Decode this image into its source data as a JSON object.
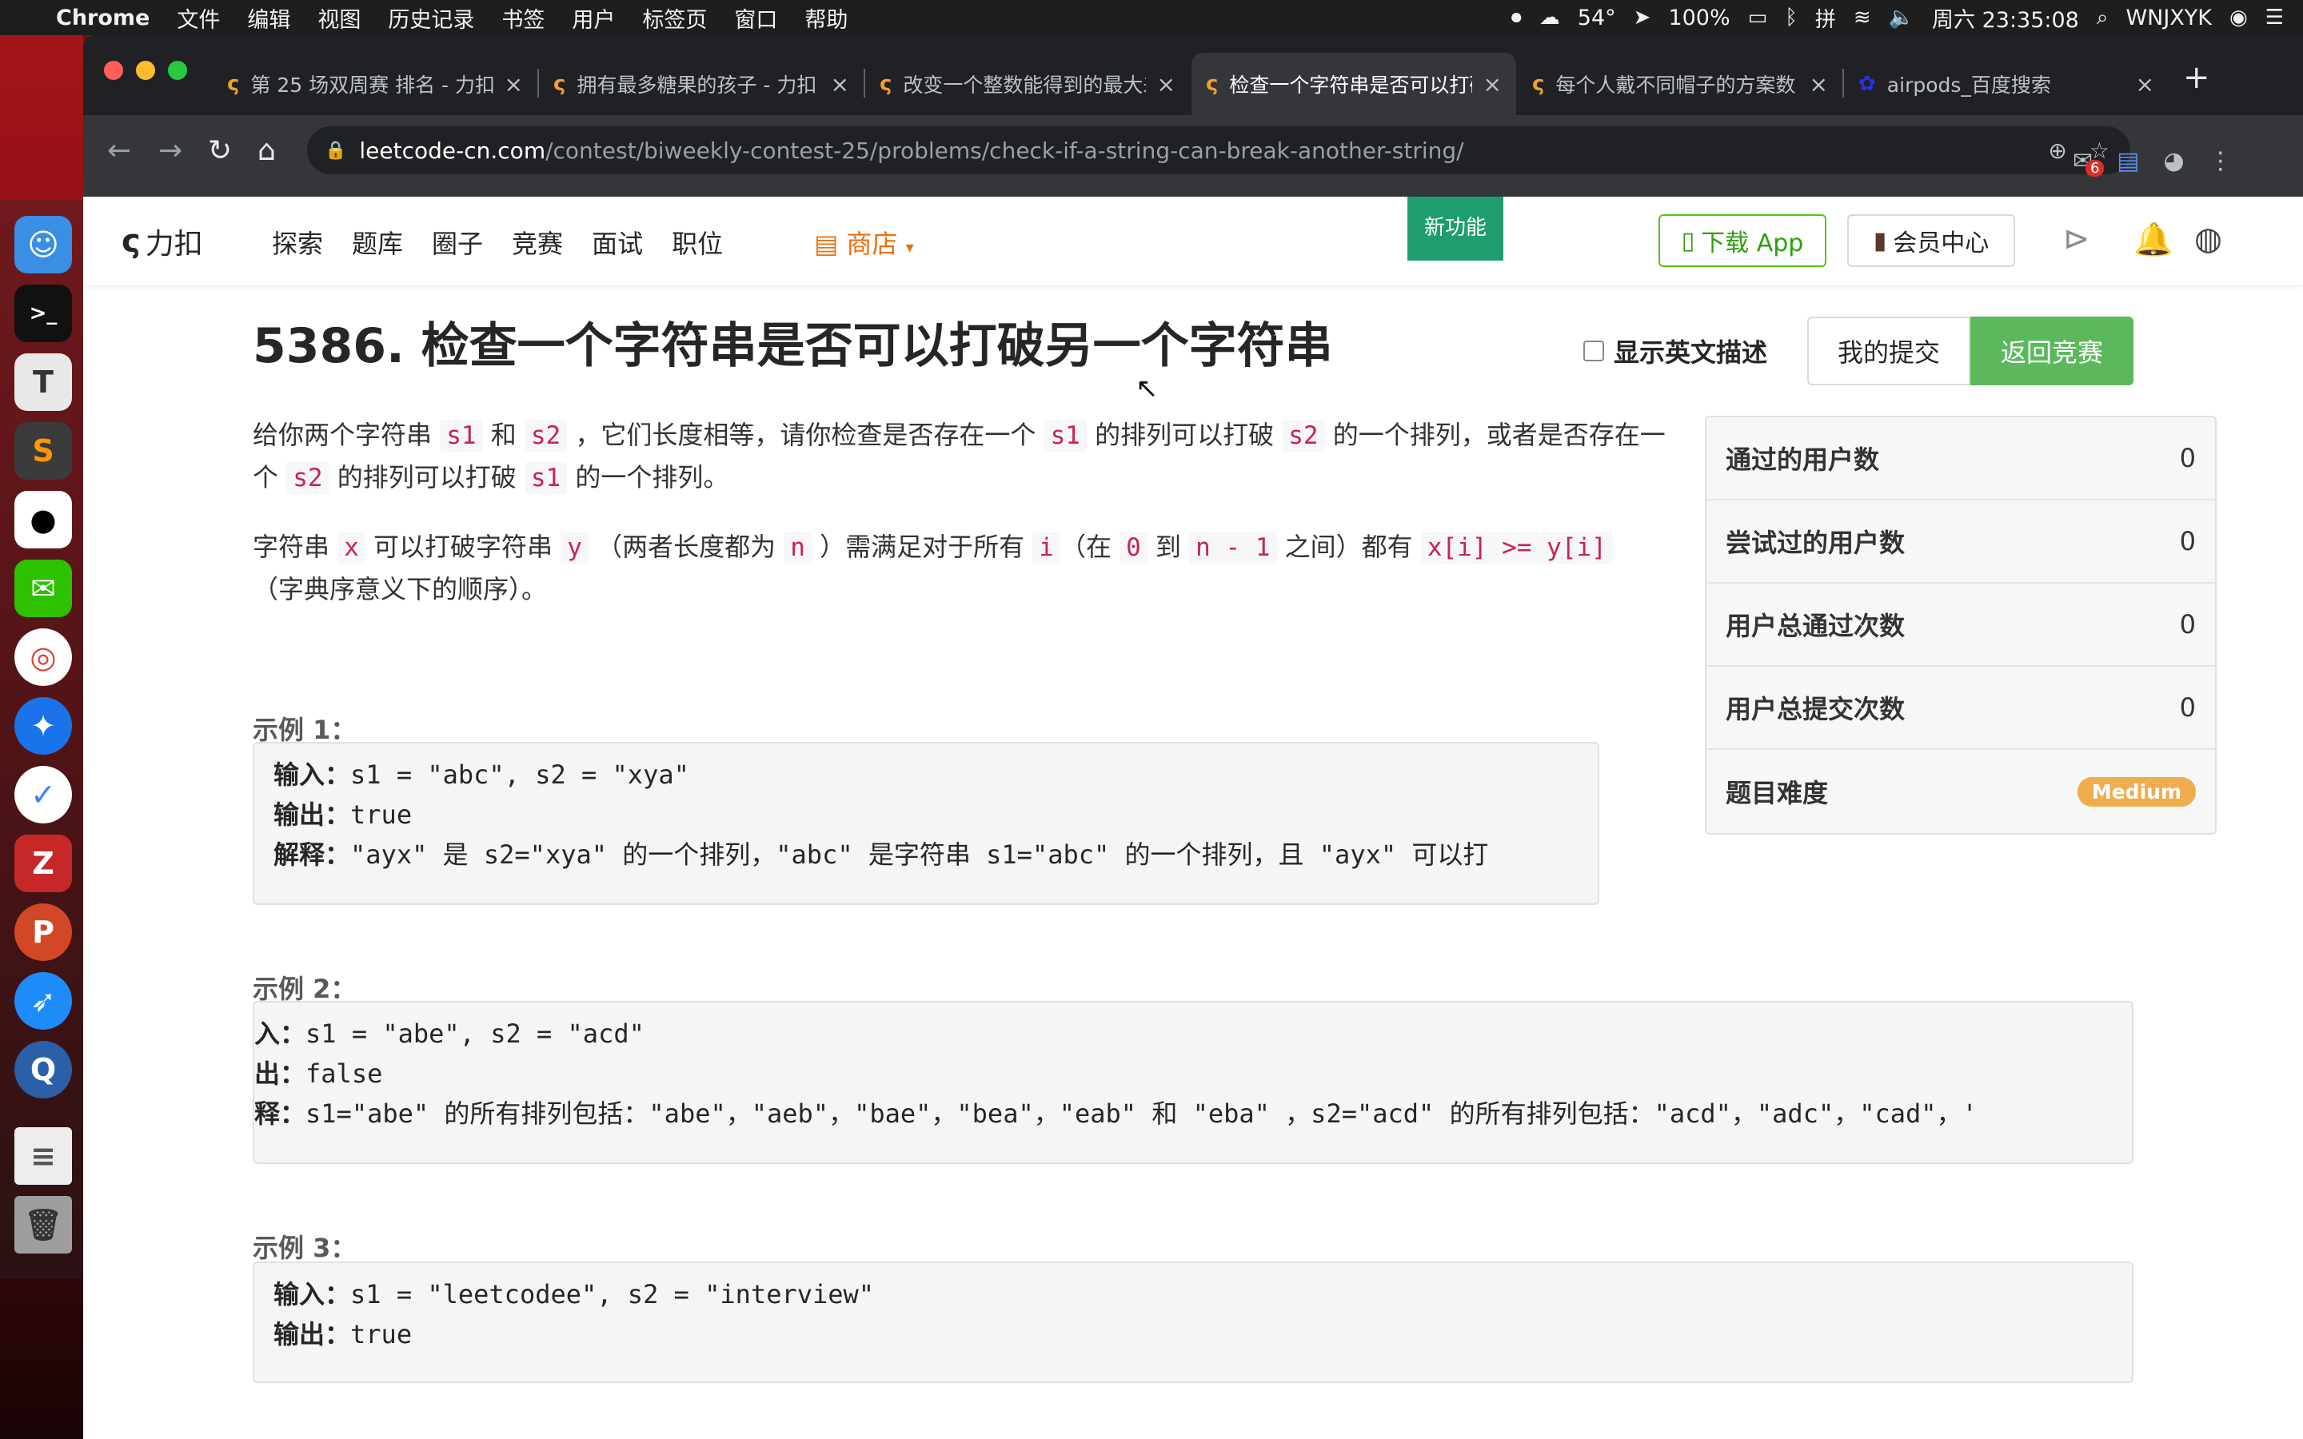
{
  "menubar": {
    "app_name": "Chrome",
    "menus": [
      "文件",
      "编辑",
      "视图",
      "历史记录",
      "书签",
      "用户",
      "标签页",
      "窗口",
      "帮助"
    ],
    "temperature": "54°",
    "battery": "100%",
    "clock": "周六 23:35:08",
    "user": "WNJXYK"
  },
  "browser": {
    "tabs": [
      {
        "title": "第 25 场双周赛 排名 - 力扣"
      },
      {
        "title": "拥有最多糖果的孩子 - 力扣"
      },
      {
        "title": "改变一个整数能得到的最大差值"
      },
      {
        "title": "检查一个字符串是否可以打破另一个字符串",
        "active": true
      },
      {
        "title": "每个人戴不同帽子的方案数"
      },
      {
        "title": "airpods_百度搜索"
      }
    ],
    "url_host": "leetcode-cn.com",
    "url_path": "/contest/biweekly-contest-25/problems/check-if-a-string-can-break-another-string/",
    "mail_badge": "6"
  },
  "lc_header": {
    "logo_text": "力扣",
    "nav": [
      "探索",
      "题库",
      "圈子",
      "竞赛",
      "面试",
      "职位"
    ],
    "shop": "商店",
    "new_feature": "新功能",
    "download_app": "下载 App",
    "vip_center": "会员中心"
  },
  "problem": {
    "title": "5386. 检查一个字符串是否可以打破另一个字符串",
    "show_english": "显示英文描述",
    "my_submissions": "我的提交",
    "back_to_contest": "返回竞赛",
    "para1": {
      "t1": "给你两个字符串 ",
      "c1": "s1",
      "t2": " 和 ",
      "c2": "s2",
      "t3": " ，它们长度相等，请你检查是否存在一个 ",
      "c3": "s1",
      "t4": " 的排列可以打破 ",
      "c4": "s2",
      "t5": " 的一个排列，或者是否存在一个 ",
      "c5": "s2",
      "t6": " 的排列可以打破 ",
      "c6": "s1",
      "t7": " 的一个排列。"
    },
    "para2": {
      "t1": "字符串 ",
      "c1": "x",
      "t2": " 可以打破字符串 ",
      "c2": "y",
      "t3": " （两者长度都为 ",
      "c3": "n",
      "t4": " ）需满足对于所有 ",
      "c4": "i",
      "t5": "（在 ",
      "c5": "0",
      "t6": " 到 ",
      "c6": "n - 1",
      "t7": " 之间）都有 ",
      "c7": "x[i] >= y[i]",
      "t8": "（字典序意义下的顺序）。"
    },
    "examples": [
      {
        "label": "示例 1：",
        "lines": [
          {
            "k": "输入：",
            "v": "s1 = \"abc\", s2 = \"xya\""
          },
          {
            "k": "输出：",
            "v": "true"
          },
          {
            "k": "解释：",
            "v": "\"ayx\" 是 s2=\"xya\" 的一个排列，\"abc\" 是字符串 s1=\"abc\" 的一个排列，且 \"ayx\" 可以打"
          }
        ]
      },
      {
        "label": "示例 2：",
        "lines": [
          {
            "k": "入：",
            "v": "s1 = \"abe\", s2 = \"acd\""
          },
          {
            "k": "出：",
            "v": "false"
          },
          {
            "k": "释：",
            "v": "s1=\"abe\" 的所有排列包括：\"abe\"，\"aeb\"，\"bae\"，\"bea\"，\"eab\" 和 \"eba\" ，s2=\"acd\" 的所有排列包括：\"acd\"，\"adc\"，\"cad\"，'"
          }
        ]
      },
      {
        "label": "示例 3：",
        "lines": [
          {
            "k": "输入：",
            "v": "s1 = \"leetcodee\", s2 = \"interview\""
          },
          {
            "k": "输出：",
            "v": "true"
          }
        ]
      }
    ]
  },
  "stats": [
    {
      "label": "通过的用户数",
      "value": "0"
    },
    {
      "label": "尝试过的用户数",
      "value": "0"
    },
    {
      "label": "用户总通过次数",
      "value": "0"
    },
    {
      "label": "用户总提交次数",
      "value": "0"
    },
    {
      "label": "题目难度",
      "badge": "Medium"
    }
  ],
  "colors": {
    "accent_green": "#5cb85c",
    "code_pink": "#c7254e",
    "shop_orange": "#e8700c",
    "medium_badge": "#f0ad4e"
  }
}
